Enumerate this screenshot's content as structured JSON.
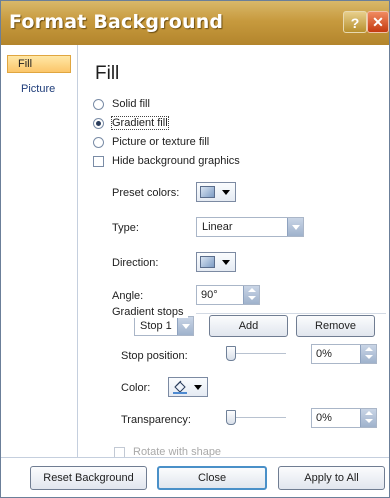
{
  "window": {
    "title": "Format Background",
    "help_glyph": "?",
    "close_glyph": "✕"
  },
  "sidebar": {
    "items": [
      {
        "label": "Fill",
        "selected": true
      },
      {
        "label": "Picture",
        "selected": false
      }
    ]
  },
  "fill": {
    "heading": "Fill",
    "options": [
      {
        "label": "Solid fill",
        "checked": false
      },
      {
        "label": "Gradient fill",
        "checked": true
      },
      {
        "label": "Picture or texture fill",
        "checked": false
      }
    ],
    "hide_bg_label": "Hide background graphics",
    "preset_label": "Preset colors:",
    "type_label": "Type:",
    "type_value": "Linear",
    "direction_label": "Direction:",
    "angle_label": "Angle:",
    "angle_value": "90°",
    "gradient_stops_label": "Gradient stops",
    "stop_value": "Stop 1",
    "add_label": "Add",
    "remove_label": "Remove",
    "stop_position_label": "Stop position:",
    "stop_position_value": "0%",
    "stop_position_fraction": 0,
    "color_label": "Color:",
    "transparency_label": "Transparency:",
    "transparency_value": "0%",
    "transparency_fraction": 0,
    "rotate_label": "Rotate with shape"
  },
  "footer": {
    "reset_label": "Reset Background",
    "close_label": "Close",
    "apply_label": "Apply to All"
  },
  "colors": {
    "titlebar": "#c79a3e",
    "selected_tab": "#fbc66a",
    "default_button_border": "#4a90c8"
  },
  "icons": {
    "preset": "gradient-swatch-icon",
    "direction": "direction-swatch-icon",
    "color": "paint-bucket-icon"
  }
}
